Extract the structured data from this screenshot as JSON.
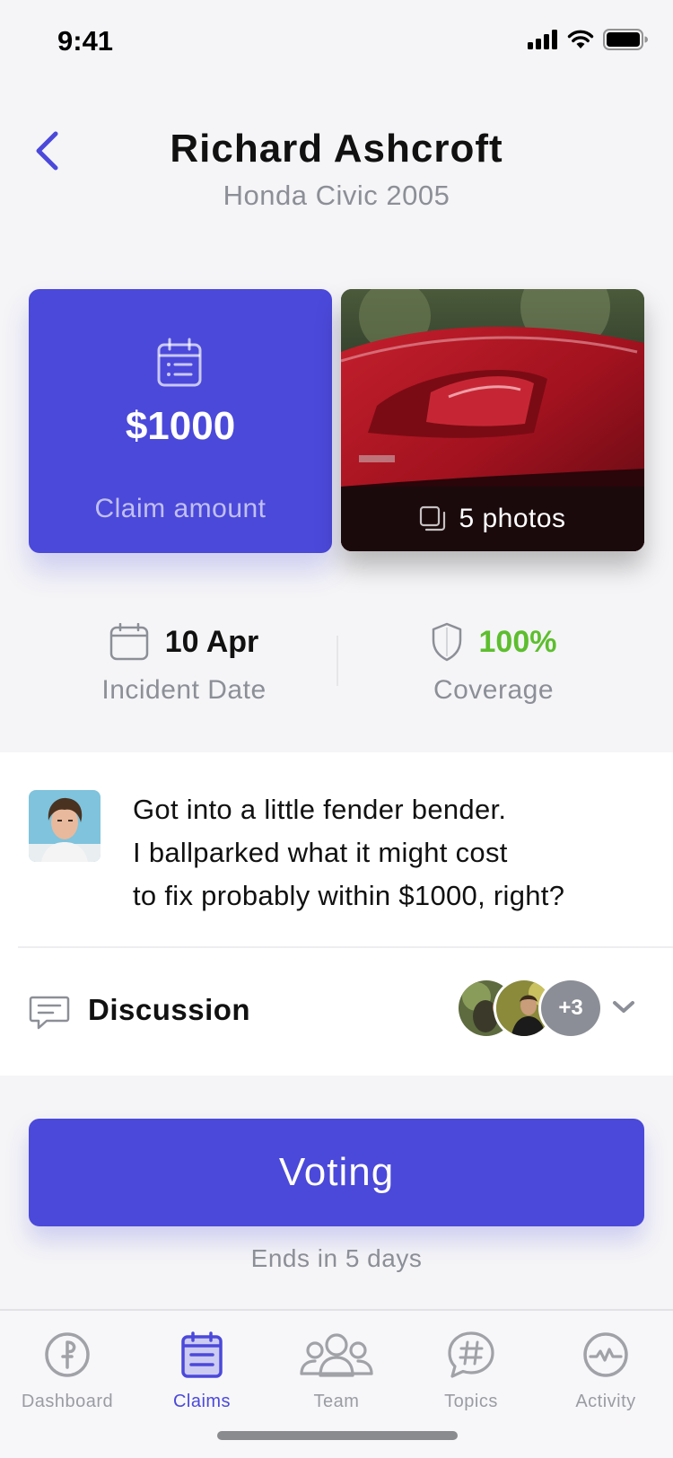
{
  "status_bar": {
    "time": "9:41"
  },
  "header": {
    "title": "Richard Ashcroft",
    "subtitle": "Honda Civic 2005"
  },
  "claim_card": {
    "amount": "$1000",
    "label": "Claim amount",
    "icon": "calendar-icon"
  },
  "photo_card": {
    "label": "5 photos",
    "icon": "photos-icon"
  },
  "stats": {
    "date": {
      "value": "10 Apr",
      "label": "Incident Date",
      "icon": "calendar-icon"
    },
    "coverage": {
      "value": "100%",
      "label": "Coverage",
      "icon": "shield-icon"
    }
  },
  "post": {
    "lines": [
      "Got into a little fender bender.",
      "I ballparked what it might cost",
      "to fix probably within $1000, right?"
    ]
  },
  "discussion": {
    "label": "Discussion",
    "more_count": "+3",
    "icon": "chat-bubble-icon"
  },
  "voting": {
    "button_label": "Voting",
    "ends_text": "Ends in 5 days"
  },
  "tab_bar": {
    "tabs": [
      {
        "label": "Dashboard",
        "icon": "dashboard-icon",
        "active": false
      },
      {
        "label": "Claims",
        "icon": "claims-icon",
        "active": true
      },
      {
        "label": "Team",
        "icon": "team-icon",
        "active": false
      },
      {
        "label": "Topics",
        "icon": "topics-icon",
        "active": false
      },
      {
        "label": "Activity",
        "icon": "activity-icon",
        "active": false
      }
    ]
  },
  "colors": {
    "accent": "#4B49DA",
    "positive": "#5DBE2E",
    "muted": "#8C8F97"
  }
}
